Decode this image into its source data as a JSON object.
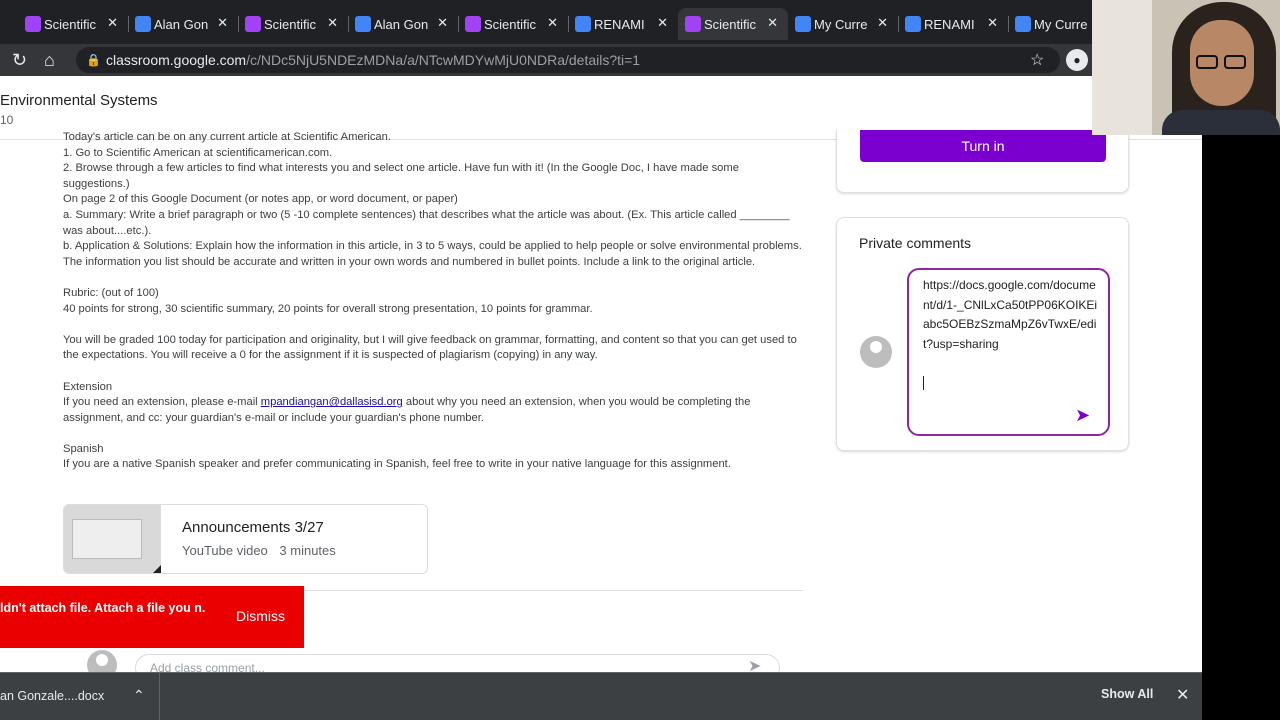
{
  "browser": {
    "tabs": [
      {
        "label": "Scientific",
        "type": "sci"
      },
      {
        "label": "Alan Gon",
        "type": "doc"
      },
      {
        "label": "Scientific",
        "type": "sci"
      },
      {
        "label": "Alan Gon",
        "type": "doc"
      },
      {
        "label": "Scientific",
        "type": "sci"
      },
      {
        "label": "RENAMI",
        "type": "doc"
      },
      {
        "label": "Scientific",
        "type": "sci",
        "active": true
      },
      {
        "label": "My Curre",
        "type": "doc"
      },
      {
        "label": "RENAMI",
        "type": "doc"
      },
      {
        "label": "My Curre",
        "type": "doc"
      }
    ],
    "url_host": "classroom.google.com",
    "url_path": "/c/NDc5NjU5NDEzMDNa/a/NTcwMDYwMjU0NDRa/details?ti=1"
  },
  "class": {
    "title": "Environmental Systems",
    "subtitle": "10"
  },
  "instructions": {
    "lines": [
      "Today's article can be on any current article at Scientific American.",
      "1. Go to Scientific American at scientificamerican.com.",
      "2. Browse through a few articles to find what interests you and select one article. Have fun with it! (In the Google Doc, I have made some suggestions.)",
      "On page 2 of this Google Document (or notes app, or word document, or paper)",
      "a. Summary: Write a brief paragraph or two (5 -10 complete sentences) that describes what the article was about. (Ex. This article called ________ was about....etc.).",
      "b. Application & Solutions: Explain how the information in this article, in 3 to 5 ways, could be applied to help people or solve environmental problems. The information you list should be accurate and written in your own words and numbered in bullet points. Include a link to the original article."
    ],
    "rubric_heading": "Rubric: (out of 100)",
    "rubric_text": "40 points for strong, 30 scientific summary, 20 points for overall strong presentation, 10 points for grammar.",
    "grading_text": "You will be graded 100 today for participation and originality, but I will give feedback on grammar, formatting, and content so that you can get used to the expectations. You will receive a 0 for the assignment if it is suspected of plagiarism (copying) in any way.",
    "extension_heading": "Extension",
    "extension_before": "If you need an extension, please e-mail ",
    "extension_email": "mpandiangan@dallasisd.org",
    "extension_after": " about why you need an extension, when you would be completing the assignment, and cc: your guardian's e-mail or include your guardian's phone number.",
    "spanish_heading": "Spanish",
    "spanish_text": "If you are a native Spanish speaker and prefer communicating in Spanish, feel free to write in your native language for this assignment."
  },
  "attachment": {
    "title": "Announcements 3/27",
    "kind": "YouTube video",
    "duration": "3 minutes"
  },
  "class_comment": {
    "placeholder": "Add class comment..."
  },
  "sidebar": {
    "turn_in_label": "Turn in",
    "private_comments_title": "Private comments",
    "private_comment_text": "https://docs.google.com/document/d/1-_CNlLxCa50tPP06KOIKEiabc5OEBzSzmaMpZ6vTwxE/edit?usp=sharing"
  },
  "toast": {
    "message": "ldn't attach file. Attach a file you n.",
    "dismiss_label": "Dismiss",
    "color": "#ea0000"
  },
  "downloads": {
    "file_name": "an Gonzale....docx",
    "show_all_label": "Show All"
  },
  "colors": {
    "accent": "#7b00cf",
    "link": "#1a0dab"
  }
}
